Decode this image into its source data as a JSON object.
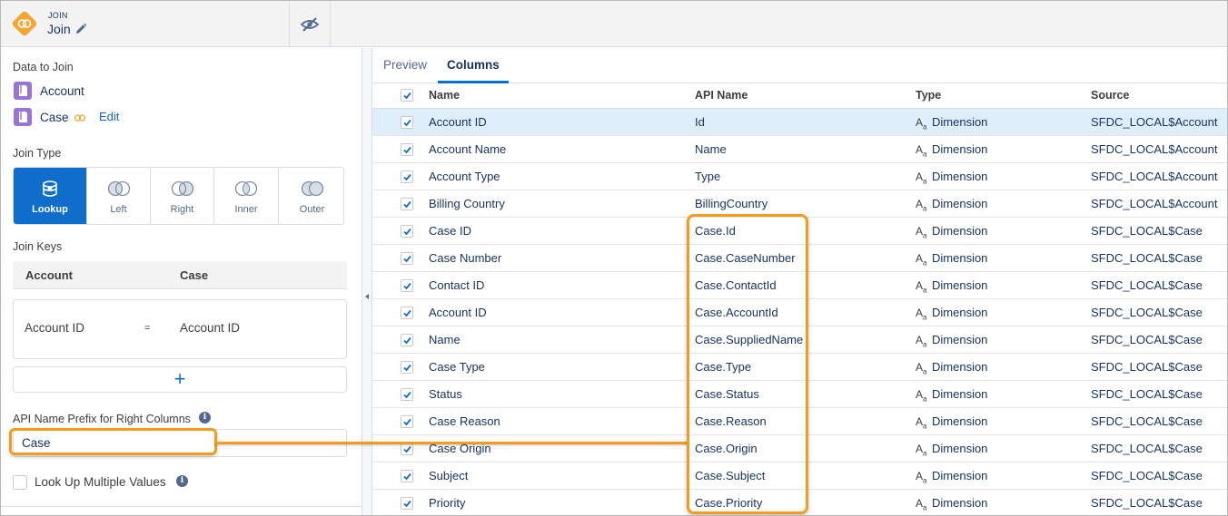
{
  "header": {
    "node_kind": "JOIN",
    "node_title": "Join",
    "colors": {
      "node_icon": "#f4a533",
      "accent": "#0f6ecb",
      "highlight": "#f29b1d"
    }
  },
  "left_panel": {
    "data_to_join_label": "Data to Join",
    "datasets": [
      {
        "name": "Account"
      },
      {
        "name": "Case"
      }
    ],
    "edit_label": "Edit",
    "join_type_label": "Join Type",
    "join_types": [
      {
        "label": "Lookup",
        "active": true
      },
      {
        "label": "Left",
        "active": false
      },
      {
        "label": "Right",
        "active": false
      },
      {
        "label": "Inner",
        "active": false
      },
      {
        "label": "Outer",
        "active": false
      }
    ],
    "join_keys_label": "Join Keys",
    "keys_header": {
      "left": "Account",
      "right": "Case"
    },
    "key_pair": {
      "left": "Account ID",
      "operator": "=",
      "right": "Account ID"
    },
    "add_key_symbol": "+",
    "prefix_label": "API Name Prefix for Right Columns",
    "prefix_value": "Case",
    "multi_values_label": "Look Up Multiple Values",
    "info_symbol": "i"
  },
  "right_panel": {
    "tabs": [
      {
        "label": "Preview",
        "active": false
      },
      {
        "label": "Columns",
        "active": true
      }
    ],
    "columns": {
      "name": "Name",
      "api_name": "API Name",
      "type": "Type",
      "source": "Source"
    },
    "rows": [
      {
        "name": "Account ID",
        "api": "Id",
        "type": "Dimension",
        "source": "SFDC_LOCAL$Account",
        "checked": true,
        "selected": true
      },
      {
        "name": "Account Name",
        "api": "Name",
        "type": "Dimension",
        "source": "SFDC_LOCAL$Account",
        "checked": true
      },
      {
        "name": "Account Type",
        "api": "Type",
        "type": "Dimension",
        "source": "SFDC_LOCAL$Account",
        "checked": true
      },
      {
        "name": "Billing Country",
        "api": "BillingCountry",
        "type": "Dimension",
        "source": "SFDC_LOCAL$Account",
        "checked": true
      },
      {
        "name": "Case ID",
        "api": "Case.Id",
        "type": "Dimension",
        "source": "SFDC_LOCAL$Case",
        "checked": true
      },
      {
        "name": "Case Number",
        "api": "Case.CaseNumber",
        "type": "Dimension",
        "source": "SFDC_LOCAL$Case",
        "checked": true
      },
      {
        "name": "Contact ID",
        "api": "Case.ContactId",
        "type": "Dimension",
        "source": "SFDC_LOCAL$Case",
        "checked": true
      },
      {
        "name": "Account ID",
        "api": "Case.AccountId",
        "type": "Dimension",
        "source": "SFDC_LOCAL$Case",
        "checked": true
      },
      {
        "name": "Name",
        "api": "Case.SuppliedName",
        "type": "Dimension",
        "source": "SFDC_LOCAL$Case",
        "checked": true
      },
      {
        "name": "Case Type",
        "api": "Case.Type",
        "type": "Dimension",
        "source": "SFDC_LOCAL$Case",
        "checked": true
      },
      {
        "name": "Status",
        "api": "Case.Status",
        "type": "Dimension",
        "source": "SFDC_LOCAL$Case",
        "checked": true
      },
      {
        "name": "Case Reason",
        "api": "Case.Reason",
        "type": "Dimension",
        "source": "SFDC_LOCAL$Case",
        "checked": true
      },
      {
        "name": "Case Origin",
        "api": "Case.Origin",
        "type": "Dimension",
        "source": "SFDC_LOCAL$Case",
        "checked": true
      },
      {
        "name": "Subject",
        "api": "Case.Subject",
        "type": "Dimension",
        "source": "SFDC_LOCAL$Case",
        "checked": true
      },
      {
        "name": "Priority",
        "api": "Case.Priority",
        "type": "Dimension",
        "source": "SFDC_LOCAL$Case",
        "checked": true
      }
    ]
  }
}
